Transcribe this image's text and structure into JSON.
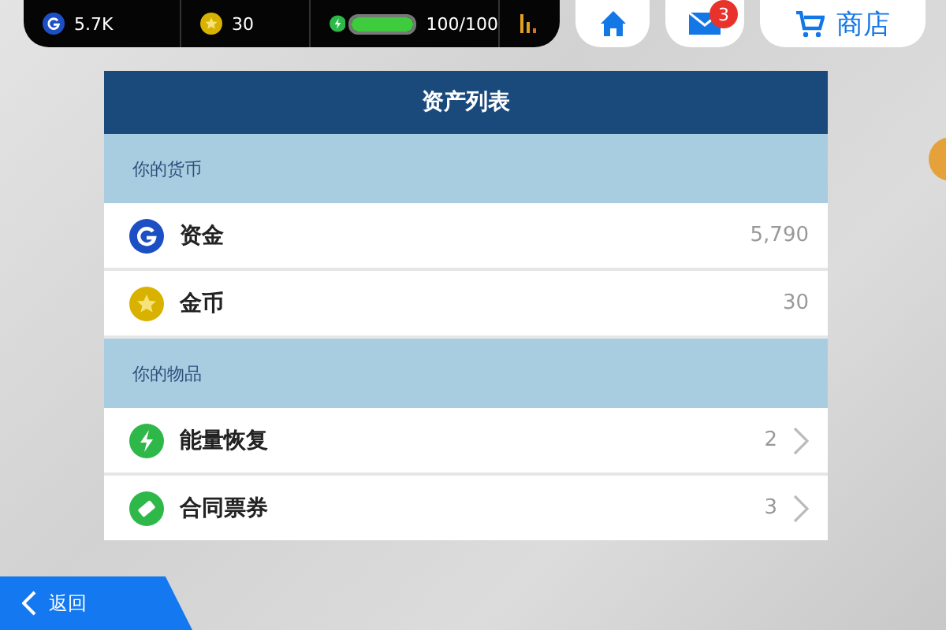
{
  "status_bar": {
    "cash": "5.7K",
    "coins": "30",
    "energy": {
      "level": 1.0,
      "reading": "100/100"
    }
  },
  "nav": {
    "mail_badge": "3",
    "shop_label": "商店"
  },
  "panel": {
    "title": "资产列表",
    "sections": [
      {
        "heading": "你的货币",
        "rows": [
          {
            "kind": "cash",
            "label": "资金",
            "value": "5,790",
            "chevron": false
          },
          {
            "kind": "coin",
            "label": "金币",
            "value": "30",
            "chevron": false
          }
        ]
      },
      {
        "heading": "你的物品",
        "rows": [
          {
            "kind": "bolt",
            "label": "能量恢复",
            "value": "2",
            "chevron": true
          },
          {
            "kind": "ticket",
            "label": "合同票券",
            "value": "3",
            "chevron": true
          }
        ]
      }
    ]
  },
  "back_button": {
    "label": "返回"
  }
}
